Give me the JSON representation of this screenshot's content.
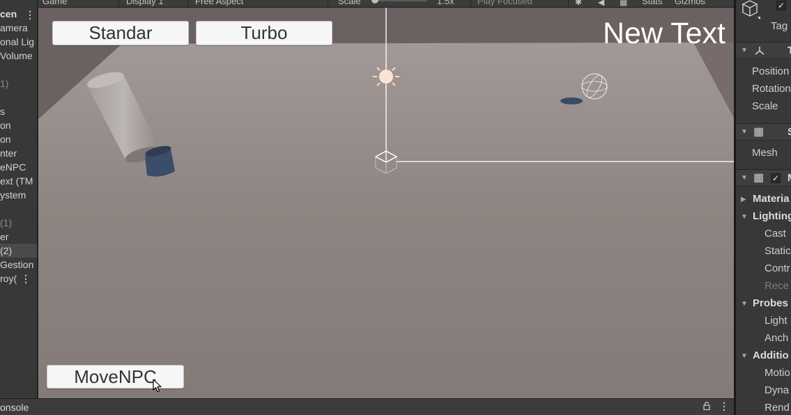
{
  "toolbar": {
    "game_tab": "Game",
    "display": "Display 1",
    "aspect": "Free Aspect",
    "scale_label": "Scale",
    "scale_value": "1.5x",
    "play_focused": "Play Focused",
    "stats": "Stats",
    "gizmos": "Gizmos"
  },
  "hierarchy": {
    "title": "cen",
    "items": [
      {
        "label": "amera",
        "state": "normal"
      },
      {
        "label": "onal Lig",
        "state": "normal"
      },
      {
        "label": " Volume",
        "state": "normal"
      },
      {
        "label": "",
        "state": "normal"
      },
      {
        "label": "1)",
        "state": "dim"
      },
      {
        "label": "",
        "state": "normal"
      },
      {
        "label": "s",
        "state": "normal"
      },
      {
        "label": "on",
        "state": "normal"
      },
      {
        "label": "on",
        "state": "normal"
      },
      {
        "label": "nter",
        "state": "normal"
      },
      {
        "label": "eNPC",
        "state": "normal"
      },
      {
        "label": "ext (TM",
        "state": "normal"
      },
      {
        "label": "ystem",
        "state": "normal"
      },
      {
        "label": "",
        "state": "normal"
      },
      {
        "label": " (1)",
        "state": "dim"
      },
      {
        "label": "er",
        "state": "normal"
      },
      {
        "label": " (2)",
        "state": "selected"
      },
      {
        "label": "Gestion",
        "state": "normal"
      },
      {
        "label": "roy(",
        "state": "normal"
      }
    ]
  },
  "game": {
    "buttons": {
      "standar": "Standar",
      "turbo": "Turbo",
      "move_npc": "MoveNPC"
    },
    "new_text": "New Text",
    "floor_color": "#8d8280",
    "wall_color": "#6b6160",
    "npc_color": "#3b4d68"
  },
  "console": {
    "tab_label": "onsole"
  },
  "inspector": {
    "tag_label": "Tag",
    "transform": {
      "position": "Position",
      "rotation": "Rotation",
      "scale": "Scale"
    },
    "mesh_filter": {
      "mesh": "Mesh"
    },
    "mesh_renderer": {
      "materials": "Materia",
      "lighting": "Lighting",
      "cast": "Cast",
      "static": "Static",
      "contribute": "Contr",
      "receive": "Rece",
      "probes": "Probes",
      "light_probes": "Light",
      "anchor": "Anch",
      "additional": "Additio",
      "motion": "Motio",
      "dynamic": "Dyna",
      "rendering": "Rend"
    }
  }
}
